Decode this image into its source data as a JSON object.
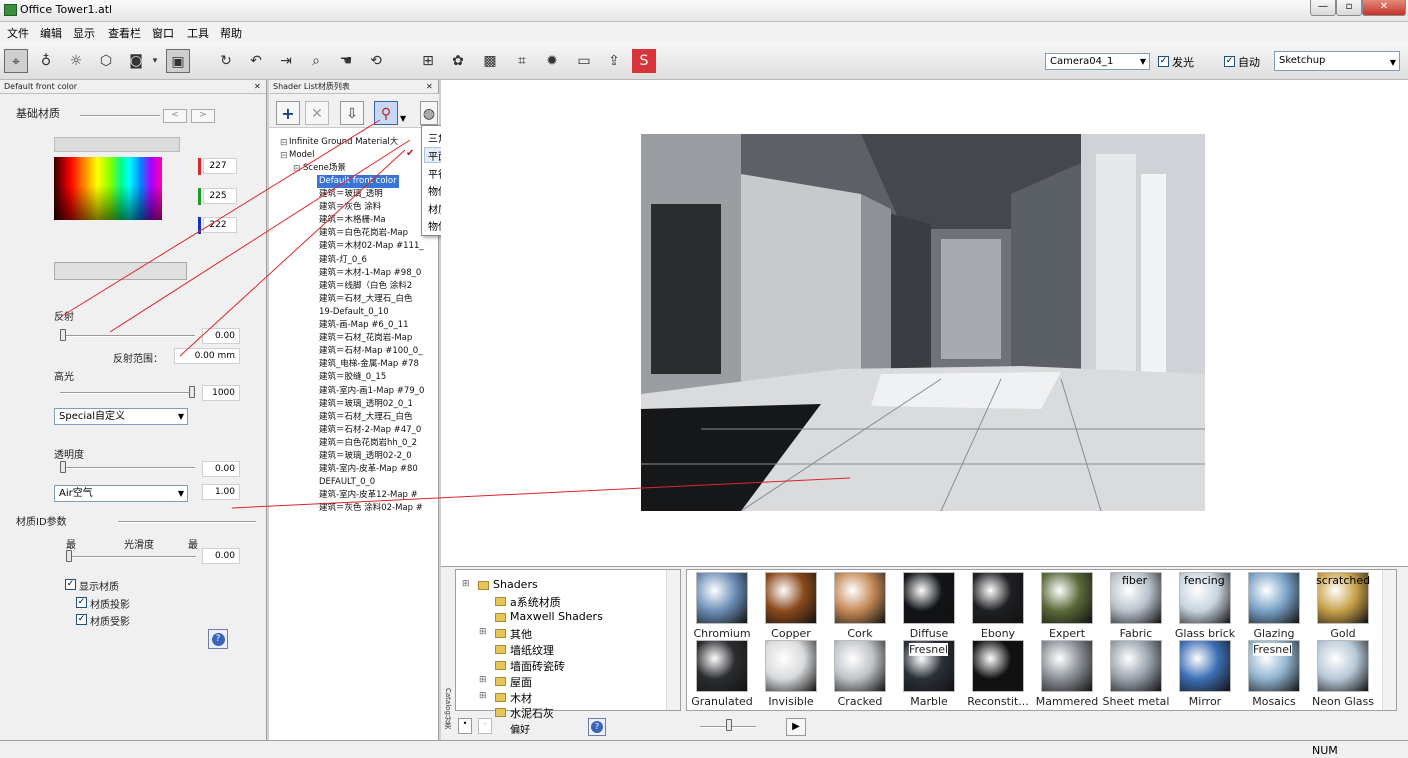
{
  "window": {
    "title": "Office Tower1.atl",
    "min": "—",
    "max": "▫",
    "close": "✕"
  },
  "menu": [
    "文件",
    "编辑",
    "显示",
    "查看栏",
    "窗口",
    "工具",
    "帮助"
  ],
  "toolbar": {
    "camera": "Camera04_1",
    "glow_label": "发光",
    "auto_label": "自动",
    "preset": "Sketchup"
  },
  "material_panel": {
    "title": "Default front color",
    "basic_material": "基础材质",
    "rgb": [
      "227",
      "225",
      "222"
    ],
    "reflection": "反射",
    "reflection_value": "0.00",
    "reflection_range_label": "反射范围：",
    "reflection_range_value": "0.00 mm",
    "highlight": "高光",
    "highlight_value": "1000",
    "special_select": "Special自定义",
    "transparency": "透明度",
    "transparency_value": "0.00",
    "medium_select": "Air空气",
    "ior_value": "1.00",
    "id_params": "材质ID参数",
    "smooth_min": "最",
    "smooth_label": "光滑度",
    "smooth_max": "最",
    "smooth_value": "0.00",
    "show_material": "显示材质",
    "cast_shadow": "材质投影",
    "receive_shadow": "材质受影",
    "help": "?"
  },
  "shader_list": {
    "title": "Shader List材质列表",
    "root_items": [
      "Infinite Ground Material大",
      "Model",
      "Scene场景"
    ],
    "selected": "Default front color",
    "items": [
      "建筑＝玻璃_透明",
      "建筑＝灰色 涂料",
      "建筑＝木格栅-Ma",
      "建筑＝白色花岗岩-Map",
      "建筑＝木材02-Map #111_",
      "建筑-灯_0_6",
      "建筑＝木材-1-Map #98_0",
      "建筑＝线脚（白色 涂料2",
      "建筑＝石材_大理石_白色",
      "19-Default_0_10",
      "建筑-画-Map #6_0_11",
      "建筑＝石材_花岗岩-Map",
      "建筑＝石材-Map #100_0_",
      "建筑_电梯-金属-Map #78",
      "建筑＝胶缝_0_15",
      "建筑-室内-画1-Map #79_0",
      "建筑＝玻璃_透明02_0_1",
      "建筑＝石材_大理石_白色",
      "建筑＝石材-2-Map #47_0",
      "建筑＝白色花岗岩hh_0_2",
      "建筑＝玻璃_透明02-2_0",
      "建筑-室内-皮革-Map #80",
      "DEFAULT_0_0",
      "建筑-室内-皮革12-Map #",
      "建筑＝灰色 涂料02-Map #"
    ]
  },
  "popup": {
    "items": [
      "三角面",
      "平面",
      "平行的面",
      "物件",
      "材质",
      "物件向导"
    ],
    "checked": "✔"
  },
  "catalog": {
    "tree": [
      "Shaders",
      "a系统材质",
      "Maxwell Shaders",
      "其他",
      "墙纸纹理",
      "墙面砖瓷砖",
      "屋面",
      "木材",
      "水泥石灰"
    ],
    "swatches_row1": [
      "Chromium",
      "Copper",
      "Cork",
      "Diffuse",
      "Ebony",
      "Expert",
      "Fabric",
      "Glass brick",
      "Glazing",
      "Gold"
    ],
    "swatches_row2": [
      "Granulated",
      "Invisible",
      "Cracked",
      "Marble",
      "Reconstit...",
      "Mammered",
      "Sheet metal",
      "Mirror",
      "Mosaics",
      "Neon Glass"
    ],
    "tags": {
      "fiber": "fiber",
      "fencing": "fencing",
      "scratched": "scratched",
      "fresnel1": "Fresnel",
      "fresnel2": "Fresnel"
    },
    "side_label": "Catalog分类",
    "bottom_label": "偏好",
    "help": "?",
    "play": "▶"
  },
  "status": {
    "num": "NUM"
  },
  "colors": {
    "accent_red": "#e0242b",
    "selection": "#3875d7"
  }
}
